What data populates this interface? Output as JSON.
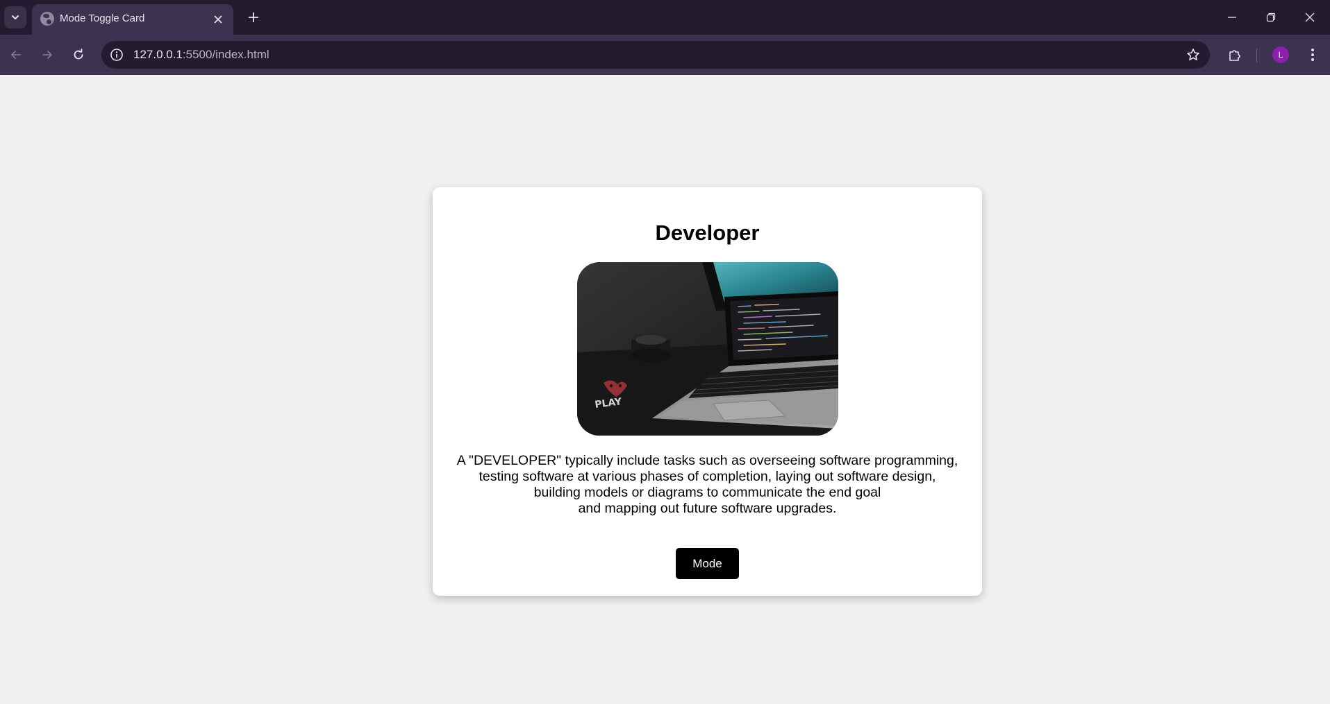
{
  "browser": {
    "tab": {
      "title": "Mode Toggle Card"
    },
    "omnibox": {
      "url_host": "127.0.0.1",
      "url_rest": ":5500/index.html"
    },
    "avatar_initial": "L",
    "colors": {
      "frame": "#231c30",
      "toolbar": "#3b3350",
      "avatar": "#8a1fb0"
    }
  },
  "card": {
    "title": "Developer",
    "description_lines": [
      "A \"DEVELOPER\" typically include tasks such as overseeing software programming,",
      "testing software at various phases of completion, laying out software design,",
      "building models or diagrams to communicate the end goal",
      "and mapping out future software upgrades."
    ],
    "button_label": "Mode",
    "image_text": "PLAY"
  },
  "colors": {
    "page_bg": "#f0f0f0",
    "card_bg": "#ffffff",
    "button_bg": "#000000"
  }
}
